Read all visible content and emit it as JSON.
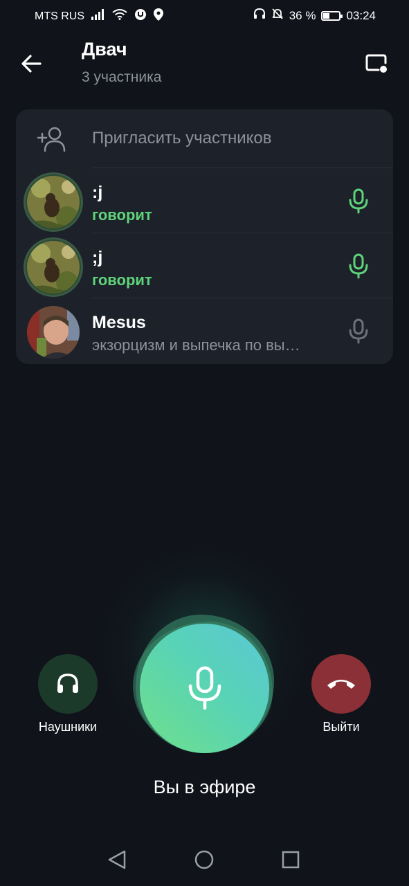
{
  "status_bar": {
    "carrier": "MTS RUS",
    "battery_percent": "36 %",
    "battery_level": 0.36,
    "time": "03:24",
    "icons": [
      "signal-icon",
      "wifi-icon",
      "vpn-icon",
      "location-icon",
      "headset-icon",
      "bell-off-icon",
      "battery-icon"
    ]
  },
  "header": {
    "title": "Двач",
    "subtitle": "3 участника"
  },
  "invite": {
    "label": "Пригласить участников"
  },
  "participants": [
    {
      "name": ":j",
      "status": "говорит",
      "state": "speaking"
    },
    {
      "name": ";j",
      "status": "говорит",
      "state": "speaking"
    },
    {
      "name": "Mesus",
      "status": "экзорцизм и выпечка по вы…",
      "state": "muted"
    }
  ],
  "controls": {
    "headphones_label": "Наушники",
    "leave_label": "Выйти",
    "on_air_label": "Вы в эфире"
  },
  "colors": {
    "background": "#10131a",
    "card": "#1d222a",
    "speaking_green": "#5fd37a",
    "muted_gray": "#8a929c",
    "leave_red": "#8b3036",
    "headphones_bg": "#1c3a2a"
  }
}
